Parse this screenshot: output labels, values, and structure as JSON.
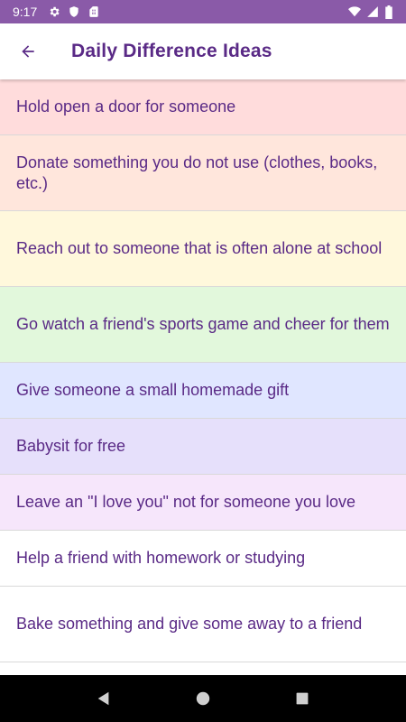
{
  "status_bar": {
    "time": "9:17",
    "icons_left": [
      "settings-icon",
      "shield-icon",
      "sim-card-icon"
    ],
    "icons_right": [
      "wifi-icon",
      "signal-icon",
      "battery-icon"
    ]
  },
  "app_bar": {
    "title": "Daily Difference Ideas",
    "back_icon": "arrow-left-icon"
  },
  "items": [
    {
      "label": "Hold open a door for someone",
      "bg": "#ffdcdc"
    },
    {
      "label": "Donate something you do not use (clothes, books, etc.)",
      "bg": "#ffe6dc"
    },
    {
      "label": "Reach out to someone that is often alone at school",
      "bg": "#fff8dc"
    },
    {
      "label": "Go watch a friend's sports game and cheer for them",
      "bg": "#e2f8dc"
    },
    {
      "label": "Give someone a small homemade gift",
      "bg": "#e0e6ff"
    },
    {
      "label": "Babysit for free",
      "bg": "#e6e0fb"
    },
    {
      "label": "Leave an \"I love you\" not for someone you love",
      "bg": "#f6e6fb"
    },
    {
      "label": "Help a friend with homework or studying",
      "bg": "#ffffff"
    },
    {
      "label": "Bake something and give some away to a friend",
      "bg": "#ffffff"
    }
  ],
  "nav_bar": {
    "buttons": [
      "back-triangle-icon",
      "home-circle-icon",
      "recents-square-icon"
    ]
  },
  "colors": {
    "status_bar": "#8a5aa8",
    "accent_text": "#5a2a86"
  }
}
